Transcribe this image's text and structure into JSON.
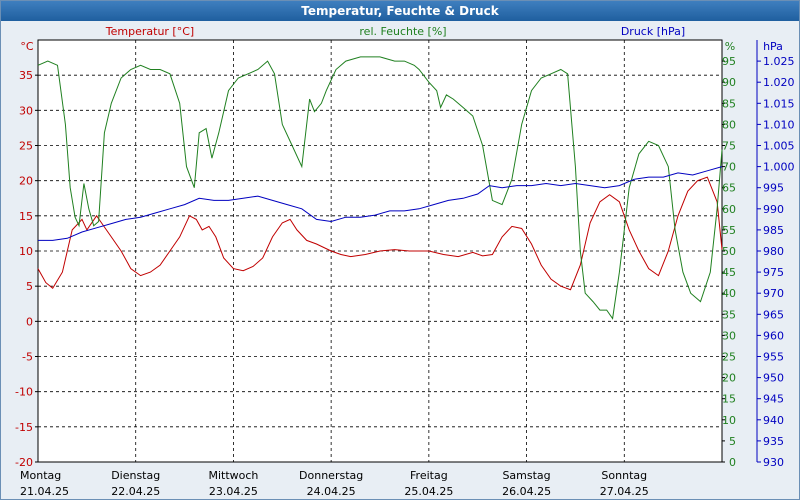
{
  "window": {
    "title": "Temperatur, Feuchte & Druck"
  },
  "chart_data": {
    "type": "line",
    "title": "Temperatur, Feuchte & Druck",
    "axes": {
      "temperature": {
        "label": "Temperatur [°C]",
        "unit": "°C",
        "min": -20,
        "max": 40,
        "ticks": [
          -20,
          -15,
          -10,
          -5,
          0,
          5,
          10,
          15,
          20,
          25,
          30,
          35
        ],
        "color": "#c00000"
      },
      "humidity": {
        "label": "rel. Feuchte [%]",
        "unit": "%",
        "min": 0,
        "max": 100,
        "ticks": [
          0,
          5,
          10,
          15,
          20,
          25,
          30,
          35,
          40,
          45,
          50,
          55,
          60,
          65,
          70,
          75,
          80,
          85,
          90,
          95
        ],
        "color": "#208020"
      },
      "pressure": {
        "label": "Druck [hPa]",
        "unit": "hPa",
        "min": 930,
        "max": 1030,
        "ticks": [
          "930",
          "935",
          "940",
          "945",
          "950",
          "955",
          "960",
          "965",
          "970",
          "975",
          "980",
          "985",
          "990",
          "995",
          "1.000",
          "1.005",
          "1.010",
          "1.015",
          "1.020",
          "1.025"
        ],
        "color": "#0000c0"
      }
    },
    "x_axis": {
      "min": 0,
      "max": 7,
      "unit": "days"
    },
    "days": [
      {
        "weekday": "Montag",
        "date": "21.04.25"
      },
      {
        "weekday": "Dienstag",
        "date": "22.04.25"
      },
      {
        "weekday": "Mittwoch",
        "date": "23.04.25"
      },
      {
        "weekday": "Donnerstag",
        "date": "24.04.25"
      },
      {
        "weekday": "Freitag",
        "date": "25.04.25"
      },
      {
        "weekday": "Samstag",
        "date": "26.04.25"
      },
      {
        "weekday": "Sonntag",
        "date": "27.04.25"
      }
    ],
    "grid": true,
    "series": [
      {
        "name": "Temperatur [°C]",
        "axis": "temperature",
        "color": "#c00000",
        "points": [
          [
            0,
            7.5
          ],
          [
            0.08,
            5.5
          ],
          [
            0.15,
            4.7
          ],
          [
            0.25,
            7
          ],
          [
            0.35,
            13
          ],
          [
            0.45,
            14.5
          ],
          [
            0.5,
            13
          ],
          [
            0.6,
            15
          ],
          [
            0.65,
            14
          ],
          [
            0.75,
            12
          ],
          [
            0.85,
            10
          ],
          [
            0.95,
            7.5
          ],
          [
            1.05,
            6.5
          ],
          [
            1.15,
            7
          ],
          [
            1.25,
            8
          ],
          [
            1.35,
            10
          ],
          [
            1.45,
            12
          ],
          [
            1.55,
            15
          ],
          [
            1.62,
            14.5
          ],
          [
            1.68,
            13
          ],
          [
            1.75,
            13.5
          ],
          [
            1.82,
            12
          ],
          [
            1.9,
            9
          ],
          [
            2.0,
            7.5
          ],
          [
            2.1,
            7.2
          ],
          [
            2.2,
            7.8
          ],
          [
            2.3,
            9
          ],
          [
            2.4,
            12
          ],
          [
            2.5,
            14
          ],
          [
            2.58,
            14.5
          ],
          [
            2.65,
            13
          ],
          [
            2.75,
            11.5
          ],
          [
            2.85,
            11
          ],
          [
            3.0,
            10
          ],
          [
            3.1,
            9.5
          ],
          [
            3.2,
            9.2
          ],
          [
            3.35,
            9.5
          ],
          [
            3.5,
            10
          ],
          [
            3.65,
            10.2
          ],
          [
            3.8,
            10
          ],
          [
            4.0,
            10
          ],
          [
            4.15,
            9.5
          ],
          [
            4.3,
            9.2
          ],
          [
            4.45,
            9.8
          ],
          [
            4.55,
            9.3
          ],
          [
            4.65,
            9.5
          ],
          [
            4.75,
            12
          ],
          [
            4.85,
            13.5
          ],
          [
            4.95,
            13.2
          ],
          [
            5.05,
            11
          ],
          [
            5.15,
            8
          ],
          [
            5.25,
            6
          ],
          [
            5.35,
            5
          ],
          [
            5.45,
            4.5
          ],
          [
            5.55,
            8
          ],
          [
            5.65,
            14
          ],
          [
            5.75,
            17
          ],
          [
            5.85,
            18
          ],
          [
            5.95,
            17
          ],
          [
            6.05,
            13
          ],
          [
            6.15,
            10
          ],
          [
            6.25,
            7.5
          ],
          [
            6.35,
            6.5
          ],
          [
            6.45,
            10
          ],
          [
            6.55,
            15
          ],
          [
            6.65,
            18.5
          ],
          [
            6.75,
            20
          ],
          [
            6.85,
            20.5
          ],
          [
            6.95,
            17
          ],
          [
            7.0,
            10.2
          ]
        ]
      },
      {
        "name": "rel. Feuchte [%]",
        "axis": "humidity",
        "color": "#208020",
        "points": [
          [
            0,
            94
          ],
          [
            0.1,
            95
          ],
          [
            0.2,
            94
          ],
          [
            0.28,
            80
          ],
          [
            0.33,
            65
          ],
          [
            0.38,
            58
          ],
          [
            0.42,
            56
          ],
          [
            0.47,
            66
          ],
          [
            0.52,
            60
          ],
          [
            0.57,
            56
          ],
          [
            0.62,
            57
          ],
          [
            0.68,
            78
          ],
          [
            0.75,
            85
          ],
          [
            0.85,
            91
          ],
          [
            0.95,
            93
          ],
          [
            1.05,
            94
          ],
          [
            1.15,
            93
          ],
          [
            1.25,
            93
          ],
          [
            1.35,
            92
          ],
          [
            1.45,
            85
          ],
          [
            1.52,
            70
          ],
          [
            1.6,
            65
          ],
          [
            1.65,
            78
          ],
          [
            1.72,
            79
          ],
          [
            1.78,
            72
          ],
          [
            1.85,
            78
          ],
          [
            1.95,
            88
          ],
          [
            2.05,
            91
          ],
          [
            2.15,
            92
          ],
          [
            2.25,
            93
          ],
          [
            2.35,
            95
          ],
          [
            2.42,
            92
          ],
          [
            2.5,
            80
          ],
          [
            2.6,
            75
          ],
          [
            2.7,
            70
          ],
          [
            2.78,
            86
          ],
          [
            2.83,
            83
          ],
          [
            2.9,
            85
          ],
          [
            2.95,
            88
          ],
          [
            3.05,
            93
          ],
          [
            3.15,
            95
          ],
          [
            3.3,
            96
          ],
          [
            3.5,
            96
          ],
          [
            3.65,
            95
          ],
          [
            3.75,
            95
          ],
          [
            3.85,
            94
          ],
          [
            3.9,
            93
          ],
          [
            4.0,
            90
          ],
          [
            4.08,
            88
          ],
          [
            4.12,
            84
          ],
          [
            4.18,
            87
          ],
          [
            4.25,
            86
          ],
          [
            4.35,
            84
          ],
          [
            4.45,
            82
          ],
          [
            4.55,
            75
          ],
          [
            4.65,
            62
          ],
          [
            4.75,
            61
          ],
          [
            4.85,
            67
          ],
          [
            4.95,
            80
          ],
          [
            5.05,
            88
          ],
          [
            5.15,
            91
          ],
          [
            5.25,
            92
          ],
          [
            5.35,
            93
          ],
          [
            5.42,
            92
          ],
          [
            5.5,
            70
          ],
          [
            5.55,
            50
          ],
          [
            5.6,
            40
          ],
          [
            5.68,
            38
          ],
          [
            5.75,
            36
          ],
          [
            5.82,
            36
          ],
          [
            5.88,
            34
          ],
          [
            5.95,
            45
          ],
          [
            6.05,
            65
          ],
          [
            6.15,
            73
          ],
          [
            6.25,
            76
          ],
          [
            6.35,
            75
          ],
          [
            6.45,
            70
          ],
          [
            6.52,
            55
          ],
          [
            6.6,
            45
          ],
          [
            6.68,
            40
          ],
          [
            6.78,
            38
          ],
          [
            6.88,
            45
          ],
          [
            6.95,
            60
          ],
          [
            7.0,
            74
          ]
        ]
      },
      {
        "name": "Druck [hPa]",
        "axis": "pressure",
        "color": "#0000c0",
        "points": [
          [
            0,
            982.5
          ],
          [
            0.15,
            982.5
          ],
          [
            0.3,
            983
          ],
          [
            0.45,
            984.5
          ],
          [
            0.6,
            985.5
          ],
          [
            0.75,
            986.5
          ],
          [
            0.9,
            987.5
          ],
          [
            1.05,
            988
          ],
          [
            1.2,
            989
          ],
          [
            1.35,
            990
          ],
          [
            1.5,
            991
          ],
          [
            1.65,
            992.5
          ],
          [
            1.8,
            992
          ],
          [
            1.95,
            992
          ],
          [
            2.1,
            992.5
          ],
          [
            2.25,
            993
          ],
          [
            2.4,
            992
          ],
          [
            2.55,
            991
          ],
          [
            2.7,
            990
          ],
          [
            2.85,
            987.5
          ],
          [
            3.0,
            987
          ],
          [
            3.15,
            988
          ],
          [
            3.3,
            988
          ],
          [
            3.45,
            988.5
          ],
          [
            3.6,
            989.5
          ],
          [
            3.75,
            989.5
          ],
          [
            3.9,
            990
          ],
          [
            4.05,
            991
          ],
          [
            4.2,
            992
          ],
          [
            4.35,
            992.5
          ],
          [
            4.5,
            993.5
          ],
          [
            4.62,
            995.5
          ],
          [
            4.75,
            995
          ],
          [
            4.9,
            995.5
          ],
          [
            5.05,
            995.5
          ],
          [
            5.2,
            996
          ],
          [
            5.35,
            995.5
          ],
          [
            5.5,
            996
          ],
          [
            5.65,
            995.5
          ],
          [
            5.8,
            995
          ],
          [
            5.95,
            995.5
          ],
          [
            6.1,
            997
          ],
          [
            6.25,
            997.5
          ],
          [
            6.4,
            997.5
          ],
          [
            6.55,
            998.5
          ],
          [
            6.7,
            998
          ],
          [
            6.85,
            999
          ],
          [
            7.0,
            1000
          ]
        ]
      }
    ]
  }
}
